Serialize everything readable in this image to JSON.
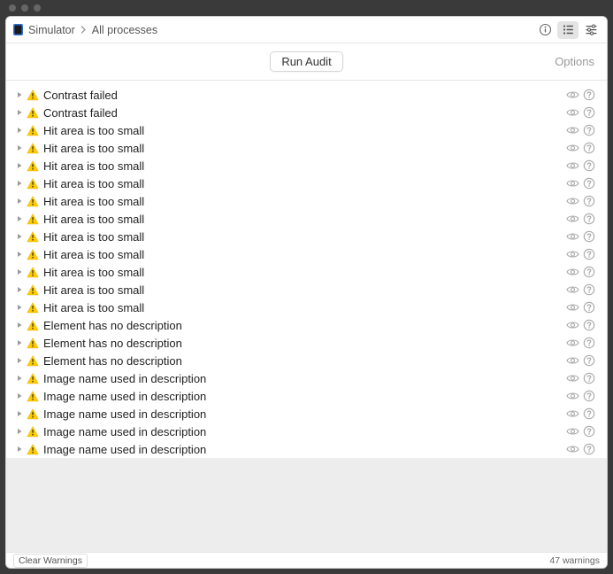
{
  "breadcrumb": {
    "item1": "Simulator",
    "item2": "All processes"
  },
  "subheader": {
    "run_audit": "Run Audit",
    "options": "Options"
  },
  "issues": [
    {
      "label": "Contrast failed"
    },
    {
      "label": "Contrast failed"
    },
    {
      "label": "Hit area is too small"
    },
    {
      "label": "Hit area is too small"
    },
    {
      "label": "Hit area is too small"
    },
    {
      "label": "Hit area is too small"
    },
    {
      "label": "Hit area is too small"
    },
    {
      "label": "Hit area is too small"
    },
    {
      "label": "Hit area is too small"
    },
    {
      "label": "Hit area is too small"
    },
    {
      "label": "Hit area is too small"
    },
    {
      "label": "Hit area is too small"
    },
    {
      "label": "Hit area is too small"
    },
    {
      "label": "Element has no description"
    },
    {
      "label": "Element has no description"
    },
    {
      "label": "Element has no description"
    },
    {
      "label": "Image name used in description"
    },
    {
      "label": "Image name used in description"
    },
    {
      "label": "Image name used in description"
    },
    {
      "label": "Image name used in description"
    },
    {
      "label": "Image name used in description"
    }
  ],
  "statusbar": {
    "clear": "Clear Warnings",
    "count": "47 warnings"
  }
}
